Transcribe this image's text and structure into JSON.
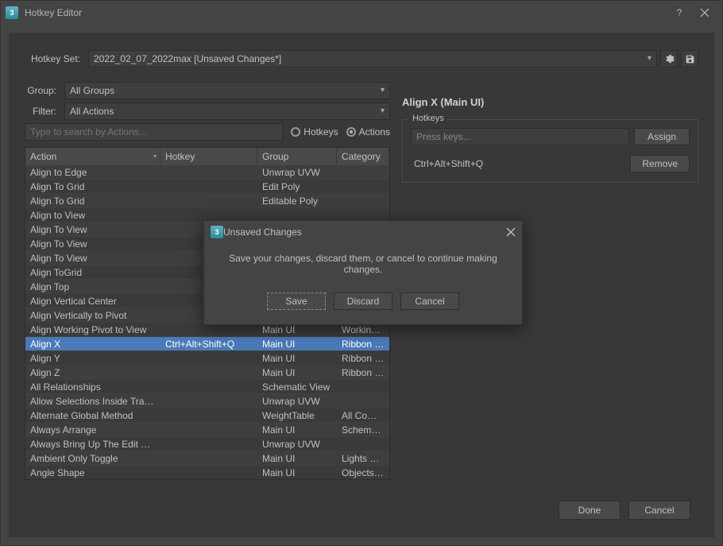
{
  "window": {
    "title": "Hotkey Editor"
  },
  "toolbar": {
    "hotkey_set_label": "Hotkey Set:",
    "hotkey_set_value": "2022_02_07_2022max [Unsaved Changes*]",
    "group_label": "Group:",
    "group_value": "All Groups",
    "filter_label": "Filter:",
    "filter_value": "All Actions"
  },
  "search": {
    "placeholder": "Type to search by Actions...",
    "radio_hotkeys": "Hotkeys",
    "radio_actions": "Actions"
  },
  "table": {
    "headers": {
      "action": "Action",
      "hotkey": "Hotkey",
      "group": "Group",
      "category": "Category"
    },
    "rows": [
      {
        "action": "Align to Edge",
        "hotkey": "",
        "group": "Unwrap UVW",
        "category": ""
      },
      {
        "action": "Align To Grid",
        "hotkey": "",
        "group": "Edit Poly",
        "category": ""
      },
      {
        "action": "Align To Grid",
        "hotkey": "",
        "group": "Editable Poly",
        "category": ""
      },
      {
        "action": "Align to View",
        "hotkey": "",
        "group": "",
        "category": ""
      },
      {
        "action": "Align To View",
        "hotkey": "",
        "group": "",
        "category": ""
      },
      {
        "action": "Align To View",
        "hotkey": "",
        "group": "",
        "category": ""
      },
      {
        "action": "Align To View",
        "hotkey": "",
        "group": "",
        "category": ""
      },
      {
        "action": "Align ToGrid",
        "hotkey": "",
        "group": "",
        "category": ""
      },
      {
        "action": "Align Top",
        "hotkey": "",
        "group": "",
        "category": ""
      },
      {
        "action": "Align Vertical Center",
        "hotkey": "",
        "group": "",
        "category": ""
      },
      {
        "action": "Align Vertically to Pivot",
        "hotkey": "",
        "group": "",
        "category": ""
      },
      {
        "action": "Align Working Pivot to View",
        "hotkey": "",
        "group": "Main UI",
        "category": "Working P"
      },
      {
        "action": "Align X",
        "hotkey": "Ctrl+Alt+Shift+Q",
        "group": "Main UI",
        "category": "Ribbon - M",
        "selected": true
      },
      {
        "action": "Align Y",
        "hotkey": "",
        "group": "Main UI",
        "category": "Ribbon - M"
      },
      {
        "action": "Align Z",
        "hotkey": "",
        "group": "Main UI",
        "category": "Ribbon - M"
      },
      {
        "action": "All Relationships",
        "hotkey": "",
        "group": "Schematic View",
        "category": ""
      },
      {
        "action": "Allow Selections Inside Tranform ...",
        "hotkey": "",
        "group": "Unwrap UVW",
        "category": ""
      },
      {
        "action": "Alternate Global Method",
        "hotkey": "",
        "group": "WeightTable",
        "category": "All Comma"
      },
      {
        "action": "Always Arrange",
        "hotkey": "",
        "group": "Main UI",
        "category": "Schematic"
      },
      {
        "action": "Always Bring Up The Edit Window",
        "hotkey": "",
        "group": "Unwrap UVW",
        "category": ""
      },
      {
        "action": "Ambient Only Toggle",
        "hotkey": "",
        "group": "Main UI",
        "category": "Lights and"
      },
      {
        "action": "Angle Shape",
        "hotkey": "",
        "group": "Main UI",
        "category": "Objects Sl"
      }
    ]
  },
  "right": {
    "title": "Align X (Main UI)",
    "fieldset_label": "Hotkeys",
    "press_placeholder": "Press keys...",
    "assign_label": "Assign",
    "remove_label": "Remove",
    "assigned_hotkey": "Ctrl+Alt+Shift+Q"
  },
  "footer": {
    "done_label": "Done",
    "cancel_label": "Cancel"
  },
  "modal": {
    "title": "Unsaved Changes",
    "message": "Save your changes, discard them, or cancel to continue making changes.",
    "save_label": "Save",
    "discard_label": "Discard",
    "cancel_label": "Cancel"
  }
}
